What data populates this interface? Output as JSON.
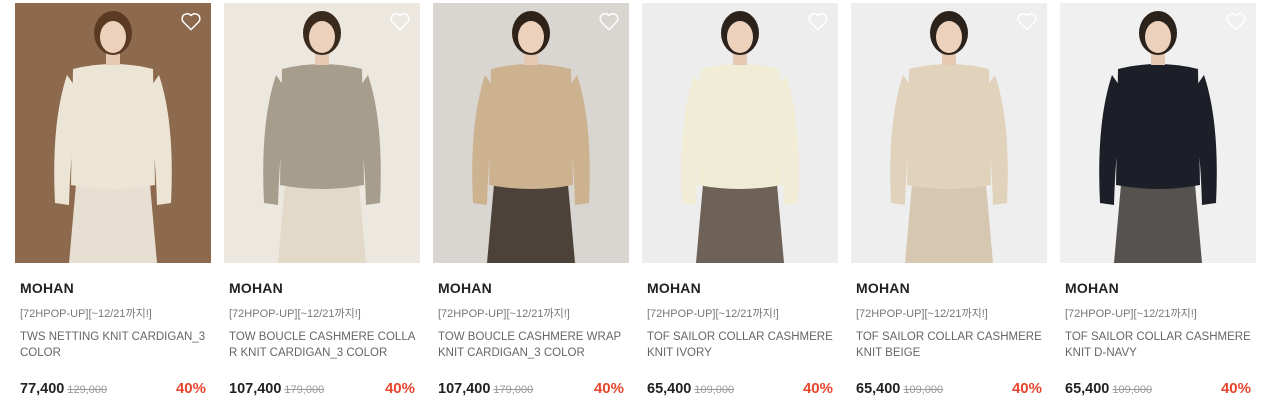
{
  "colors": {
    "discount": "#e8462d",
    "price": "#222222",
    "original_price": "#999999",
    "brand": "#222222"
  },
  "products": [
    {
      "brand": "MOHAN",
      "promo": "[72HPOP-UP][~12/21까지!]",
      "name": "TWS NETTING KNIT CARDIGAN_3 COLOR",
      "price": "77,400",
      "original_price": "129,000",
      "discount": "40%",
      "wishlist_icon": "heart-outline-icon",
      "image": {
        "bg": "#8d6a4d",
        "top": "#ece5d6",
        "bottom": "#e7e0d2",
        "hair": "#5a3a22"
      }
    },
    {
      "brand": "MOHAN",
      "promo": "[72HPOP-UP][~12/21까지!]",
      "name": "TOW BOUCLE CASHMERE COLLAR KNIT CARDIGAN_3 COLOR",
      "price": "107,400",
      "original_price": "179,000",
      "discount": "40%",
      "wishlist_icon": "heart-outline-icon",
      "image": {
        "bg": "#ece7df",
        "top": "#a79d8d",
        "bottom": "#e3d9c9",
        "hair": "#3a2a1e"
      }
    },
    {
      "brand": "MOHAN",
      "promo": "[72HPOP-UP][~12/21까지!]",
      "name": "TOW BOUCLE CASHMERE WRAP KNIT CARDIGAN_3 COLOR",
      "price": "107,400",
      "original_price": "179,000",
      "discount": "40%",
      "wishlist_icon": "heart-outline-icon",
      "image": {
        "bg": "#d9d6d1",
        "top": "#cdb290",
        "bottom": "#4c423a",
        "hair": "#2e2219"
      }
    },
    {
      "brand": "MOHAN",
      "promo": "[72HPOP-UP][~12/21까지!]",
      "name": "TOF SAILOR COLLAR CASHMERE KNIT IVORY",
      "price": "65,400",
      "original_price": "109,000",
      "discount": "40%",
      "wishlist_icon": "heart-outline-icon",
      "image": {
        "bg": "#ededed",
        "top": "#f1ecd6",
        "bottom": "#6e6258",
        "hair": "#2c221c"
      }
    },
    {
      "brand": "MOHAN",
      "promo": "[72HPOP-UP][~12/21까지!]",
      "name": "TOF SAILOR COLLAR CASHMERE KNIT BEIGE",
      "price": "65,400",
      "original_price": "109,000",
      "discount": "40%",
      "wishlist_icon": "heart-outline-icon",
      "image": {
        "bg": "#eeeeee",
        "top": "#e0d2bb",
        "bottom": "#d6c7b0",
        "hair": "#2c221c"
      }
    },
    {
      "brand": "MOHAN",
      "promo": "[72HPOP-UP][~12/21까지!]",
      "name": "TOF SAILOR COLLAR CASHMERE KNIT D-NAVY",
      "price": "65,400",
      "original_price": "109,000",
      "discount": "40%",
      "wishlist_icon": "heart-outline-icon",
      "image": {
        "bg": "#f0f0f0",
        "top": "#1c1f27",
        "bottom": "#56524f",
        "hair": "#2c221c"
      }
    }
  ]
}
